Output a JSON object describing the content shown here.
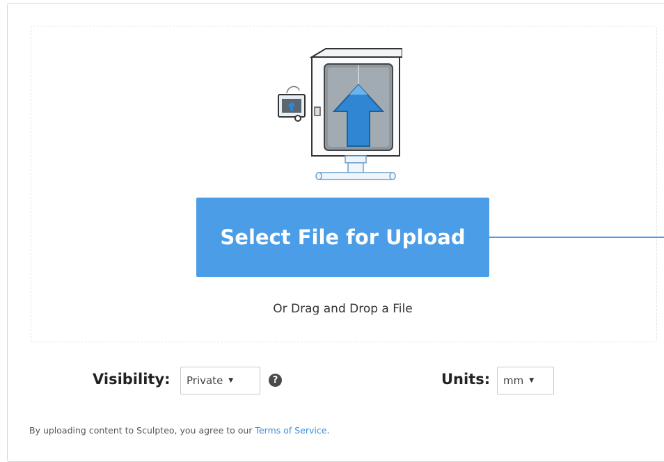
{
  "upload": {
    "button_label": "Select File for Upload",
    "drag_text": "Or Drag and Drop a File"
  },
  "settings": {
    "visibility_label": "Visibility:",
    "visibility_value": "Private",
    "units_label": "Units:",
    "units_value": "mm",
    "help_icon_glyph": "?"
  },
  "terms": {
    "prefix": "By uploading content to Sculpteo, you agree to our ",
    "link": "Terms of Service",
    "suffix": "."
  },
  "icons": {
    "illustration": "printer-upload-illustration-icon",
    "help": "question-circle-icon",
    "caret": "caret-down-icon"
  },
  "colors": {
    "accent": "#4a9de6",
    "link": "#3a8bd8"
  }
}
